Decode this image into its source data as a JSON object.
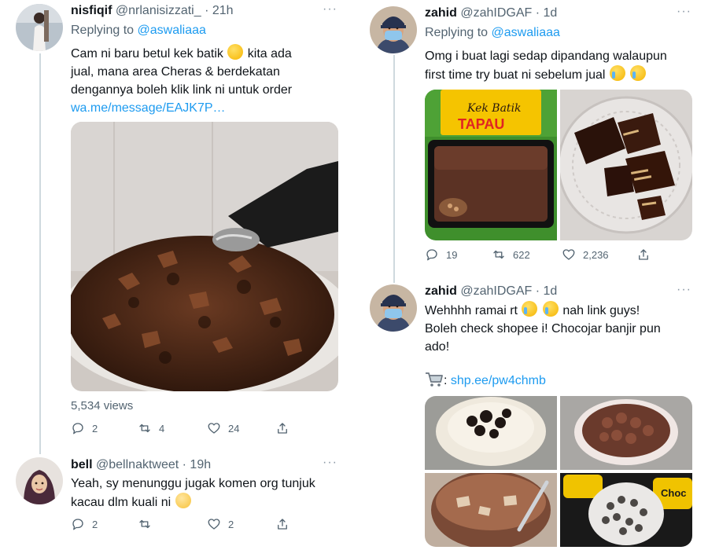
{
  "left": {
    "tweet1": {
      "name": "nisfiqif",
      "handle": "@nrlanisizzati_",
      "time": "· 21h",
      "replying_label": "Replying to",
      "replying_to": "@aswaliaaa",
      "text_line1": "Cam ni baru betul kek batik",
      "text_line1b": "kita ada",
      "text_line2": "jual, mana area Cheras & berdekatan",
      "text_line3": "dengannya boleh klik link ni untuk order",
      "link": "wa.me/message/EAJK7P…",
      "views": "5,534 views",
      "replies": "2",
      "retweets": "4",
      "likes": "24"
    },
    "tweet2": {
      "name": "bell",
      "handle": "@bellnaktweet",
      "time": "· 19h",
      "text_line1": "Yeah, sy menunggu jugak komen org tunjuk",
      "text_line2": "kacau dlm kuali ni",
      "replies": "2",
      "retweets": "",
      "likes": "2"
    }
  },
  "right": {
    "tweet1": {
      "name": "zahid",
      "handle": "@zahIDGAF",
      "time": "· 1d",
      "replying_label": "Replying to",
      "replying_to": "@aswaliaaa",
      "text_line1": "Omg i buat lagi sedap dipandang walaupun",
      "text_line2": "first time try buat ni sebelum jual",
      "brand_line1": "Kek Batik",
      "brand_line2": "TAPAU",
      "replies": "19",
      "retweets": "622",
      "likes": "2,236"
    },
    "tweet2": {
      "name": "zahid",
      "handle": "@zahIDGAF",
      "time": "· 1d",
      "text_line1a": "Wehhhh ramai rt",
      "text_line1b": "nah link guys!",
      "text_line2": "Boleh check shopee i! Chocojar banjir pun",
      "text_line3": "ado!",
      "link_prefix": ":",
      "link": "shp.ee/pw4chmb",
      "jar_label": "Choc"
    }
  },
  "more_label": "···"
}
